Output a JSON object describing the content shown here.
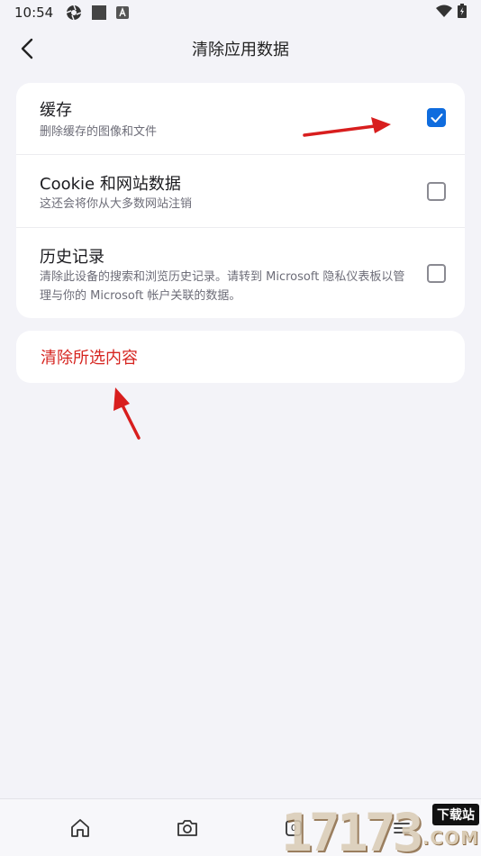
{
  "status_bar": {
    "time": "10:54",
    "icons": [
      "aperture-icon",
      "square-icon",
      "a-badge-icon"
    ],
    "right_icons": [
      "wifi-icon",
      "battery-icon"
    ]
  },
  "header": {
    "title": "清除应用数据",
    "back_icon": "chevron-left-icon"
  },
  "options": [
    {
      "label": "缓存",
      "description": "删除缓存的图像和文件",
      "checked": true
    },
    {
      "label": "Cookie 和网站数据",
      "description": "这还会将你从大多数网站注销",
      "checked": false
    },
    {
      "label": "历史记录",
      "description": "清除此设备的搜索和浏览历史记录。请转到 Microsoft 隐私仪表板以管理与你的 Microsoft 帐户关联的数据。",
      "checked": false
    }
  ],
  "action": {
    "label": "清除所选内容"
  },
  "bottom_nav": {
    "items": [
      "home-icon",
      "camera-icon",
      "tabs-icon",
      "menu-icon"
    ],
    "tab_count": "0"
  },
  "watermark": {
    "digits": "17173",
    "tag": "下载站",
    "domain": ".COM"
  },
  "colors": {
    "accent": "#0f6cde",
    "danger": "#d62520",
    "background": "#f3f3f8",
    "card": "#ffffff",
    "annotation_arrow": "#d81e1e"
  }
}
